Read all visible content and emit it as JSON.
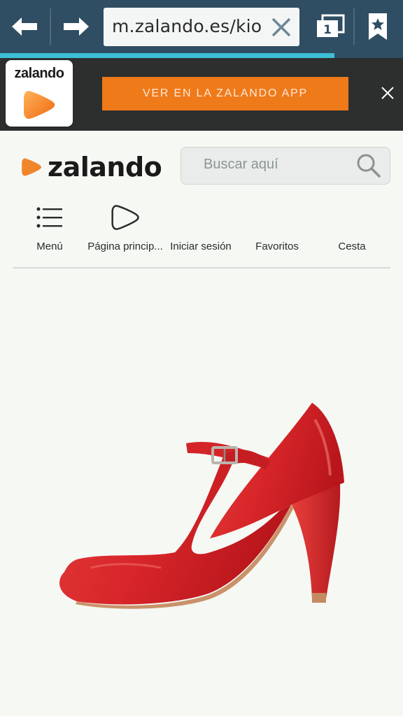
{
  "browser": {
    "url": "m.zalando.es/kion",
    "tab_count": "1",
    "load_progress": 0.83
  },
  "app_banner": {
    "icon_label": "zalando",
    "button_label": "VER EN LA ZALANDO APP"
  },
  "header": {
    "logo_text": "zalando",
    "search_placeholder": "Buscar aquí"
  },
  "nav": {
    "items": [
      {
        "label": "Menú",
        "icon": "menu-list-icon"
      },
      {
        "label": "Página princip...",
        "icon": "zalando-play-icon"
      },
      {
        "label": "Iniciar sesión",
        "icon": "none"
      },
      {
        "label": "Favoritos",
        "icon": "none"
      },
      {
        "label": "Cesta",
        "icon": "none"
      }
    ]
  },
  "product": {
    "image": "red-strap-high-heel-shoe"
  },
  "colors": {
    "browser_bar": "#2f4e63",
    "progress": "#3dbfd6",
    "banner_bg": "#2c2f2e",
    "app_button": "#ef7a1a",
    "brand_orange": "#f0852a",
    "shoe_red": "#d8262a"
  }
}
